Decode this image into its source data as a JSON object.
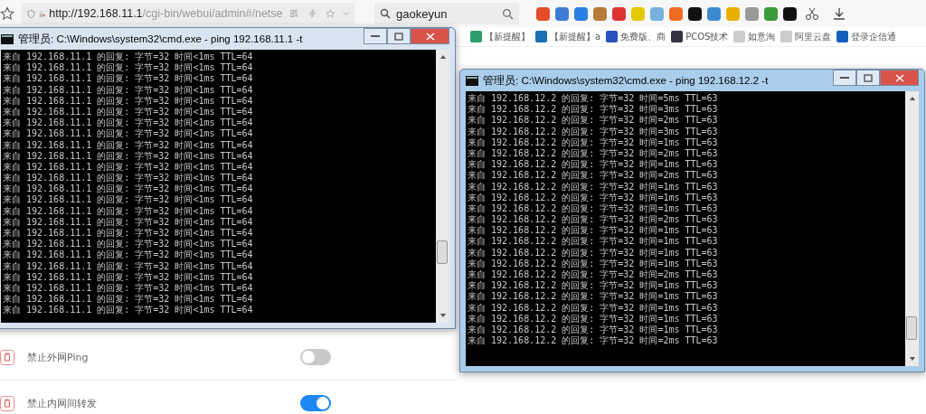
{
  "browser": {
    "url_host": "http://192.168.11.1",
    "url_path": "/cgi-bin/webui/admin#/netse",
    "search": {
      "value": "gaokeyun"
    },
    "bookmarks": [
      {
        "label": "【新提醒】"
      },
      {
        "label": "【新提醒】a"
      },
      {
        "label": "免费版、商"
      },
      {
        "label": "PCOS技术"
      },
      {
        "label": "如意淘"
      },
      {
        "label": "阿里云盘"
      },
      {
        "label": "登录企信通"
      }
    ]
  },
  "settings": [
    {
      "label": "禁止外网Ping",
      "on": false
    },
    {
      "label": "禁止内网间转发",
      "on": true
    }
  ],
  "windows": [
    {
      "title": "管理员: C:\\Windows\\system32\\cmd.exe - ping  192.168.11.1 -t",
      "active": false,
      "lines": [
        "来自 192.168.11.1 的回复: 字节=32 时间<1ms TTL=64",
        "来自 192.168.11.1 的回复: 字节=32 时间<1ms TTL=64",
        "来自 192.168.11.1 的回复: 字节=32 时间<1ms TTL=64",
        "来自 192.168.11.1 的回复: 字节=32 时间<1ms TTL=64",
        "来自 192.168.11.1 的回复: 字节=32 时间<1ms TTL=64",
        "来自 192.168.11.1 的回复: 字节=32 时间<1ms TTL=64",
        "来自 192.168.11.1 的回复: 字节=32 时间<1ms TTL=64",
        "来自 192.168.11.1 的回复: 字节=32 时间<1ms TTL=64",
        "来自 192.168.11.1 的回复: 字节=32 时间<1ms TTL=64",
        "来自 192.168.11.1 的回复: 字节=32 时间<1ms TTL=64",
        "来自 192.168.11.1 的回复: 字节=32 时间<1ms TTL=64",
        "来自 192.168.11.1 的回复: 字节=32 时间<1ms TTL=64",
        "来自 192.168.11.1 的回复: 字节=32 时间<1ms TTL=64",
        "来自 192.168.11.1 的回复: 字节=32 时间<1ms TTL=64",
        "来自 192.168.11.1 的回复: 字节=32 时间<1ms TTL=64",
        "来自 192.168.11.1 的回复: 字节=32 时间<1ms TTL=64",
        "来自 192.168.11.1 的回复: 字节=32 时间<1ms TTL=64",
        "来自 192.168.11.1 的回复: 字节=32 时间<1ms TTL=64",
        "来自 192.168.11.1 的回复: 字节=32 时间<1ms TTL=64",
        "来自 192.168.11.1 的回复: 字节=32 时间<1ms TTL=64",
        "来自 192.168.11.1 的回复: 字节=32 时间<1ms TTL=64",
        "来自 192.168.11.1 的回复: 字节=32 时间<1ms TTL=64",
        "来自 192.168.11.1 的回复: 字节=32 时间<1ms TTL=64",
        "来自 192.168.11.1 的回复: 字节=32 时间<1ms TTL=64"
      ]
    },
    {
      "title": "管理员: C:\\Windows\\system32\\cmd.exe - ping  192.168.12.2 -t",
      "active": true,
      "lines": [
        "来自 192.168.12.2 的回复: 字节=32 时间=5ms TTL=63",
        "来自 192.168.12.2 的回复: 字节=32 时间=3ms TTL=63",
        "来自 192.168.12.2 的回复: 字节=32 时间=2ms TTL=63",
        "来自 192.168.12.2 的回复: 字节=32 时间=3ms TTL=63",
        "来自 192.168.12.2 的回复: 字节=32 时间=1ms TTL=63",
        "来自 192.168.12.2 的回复: 字节=32 时间=2ms TTL=63",
        "来自 192.168.12.2 的回复: 字节=32 时间=1ms TTL=63",
        "来自 192.168.12.2 的回复: 字节=32 时间=2ms TTL=63",
        "来自 192.168.12.2 的回复: 字节=32 时间=1ms TTL=63",
        "来自 192.168.12.2 的回复: 字节=32 时间=1ms TTL=63",
        "来自 192.168.12.2 的回复: 字节=32 时间=1ms TTL=63",
        "来自 192.168.12.2 的回复: 字节=32 时间=2ms TTL=63",
        "来自 192.168.12.2 的回复: 字节=32 时间=1ms TTL=63",
        "来自 192.168.12.2 的回复: 字节=32 时间=1ms TTL=63",
        "来自 192.168.12.2 的回复: 字节=32 时间=1ms TTL=63",
        "来自 192.168.12.2 的回复: 字节=32 时间=1ms TTL=63",
        "来自 192.168.12.2 的回复: 字节=32 时间=2ms TTL=63",
        "来自 192.168.12.2 的回复: 字节=32 时间=1ms TTL=63",
        "来自 192.168.12.2 的回复: 字节=32 时间=1ms TTL=63",
        "来自 192.168.12.2 的回复: 字节=32 时间=1ms TTL=63",
        "来自 192.168.12.2 的回复: 字节=32 时间=1ms TTL=63",
        "来自 192.168.12.2 的回复: 字节=32 时间=1ms TTL=63",
        "来自 192.168.12.2 的回复: 字节=32 时间=2ms TTL=63"
      ]
    }
  ]
}
